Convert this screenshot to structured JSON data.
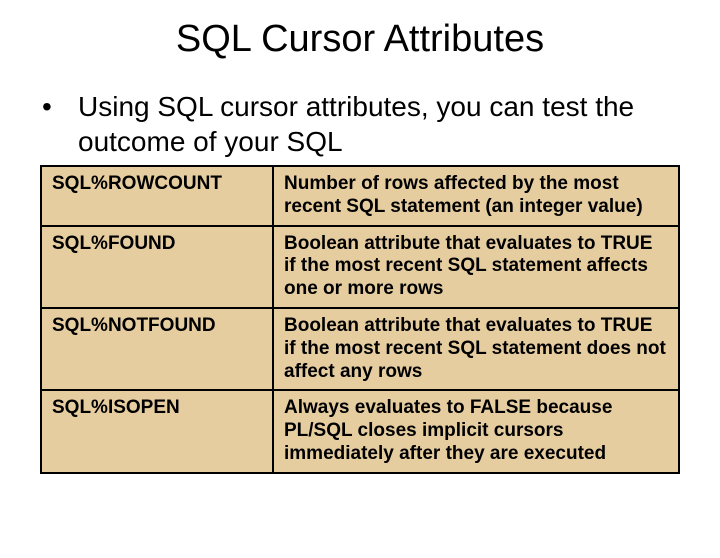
{
  "title": "SQL Cursor Attributes",
  "bullet": "Using SQL cursor attributes, you can test the outcome of your SQL",
  "rows": [
    {
      "attr": "SQL%ROWCOUNT",
      "desc": "Number of rows affected by the most recent SQL statement (an integer value)"
    },
    {
      "attr": "SQL%FOUND",
      "desc": "Boolean attribute that evaluates to TRUE if the most recent SQL statement affects one  or more rows"
    },
    {
      "attr": "SQL%NOTFOUND",
      "desc": "Boolean attribute that evaluates to TRUE if the most recent SQL statement does not affect any rows"
    },
    {
      "attr": "SQL%ISOPEN",
      "desc": "Always evaluates to FALSE because PL/SQL closes implicit cursors immediately after they are executed"
    }
  ]
}
